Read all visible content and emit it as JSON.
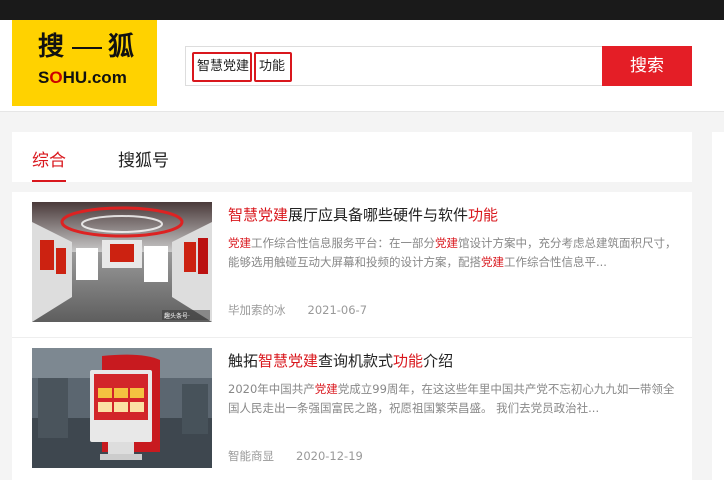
{
  "logo": {
    "cn_left": "搜",
    "cn_right": "狐",
    "en_pre": "S",
    "en_o": "O",
    "en_post": "HU.com"
  },
  "search": {
    "terms": [
      "智慧党建",
      "功能"
    ],
    "button_label": "搜索"
  },
  "tabs": [
    {
      "label": "综合",
      "active": true
    },
    {
      "label": "搜狐号",
      "active": false
    }
  ],
  "results": [
    {
      "title_parts": [
        {
          "text": "智慧党建",
          "hl": true
        },
        {
          "text": "展厅应具备哪些硬件与软件",
          "hl": false
        },
        {
          "text": "功能",
          "hl": true
        }
      ],
      "desc_parts": [
        {
          "text": "党建",
          "hl": true
        },
        {
          "text": "工作综合性信息服务平台：在一部分",
          "hl": false
        },
        {
          "text": "党建",
          "hl": true
        },
        {
          "text": "馆设计方案中，充分考虑总建筑面积尺寸，能够选用触碰互动大屏幕和投频的设计方案，配搭",
          "hl": false
        },
        {
          "text": "党建",
          "hl": true
        },
        {
          "text": "工作综合性信息平...",
          "hl": false
        }
      ],
      "author": "毕加索的冰",
      "date": "2021-06-7",
      "thumb_watermark": "趣头条号·",
      "colors": {
        "accent": "#d9171d"
      }
    },
    {
      "title_parts": [
        {
          "text": "触拓",
          "hl": false
        },
        {
          "text": "智慧党建",
          "hl": true
        },
        {
          "text": "查询机款式",
          "hl": false
        },
        {
          "text": "功能",
          "hl": true
        },
        {
          "text": "介绍",
          "hl": false
        }
      ],
      "desc_parts": [
        {
          "text": "2020年中国共产",
          "hl": false
        },
        {
          "text": "党建",
          "hl": true
        },
        {
          "text": "党成立99周年，在这这些年里中国共产党不忘初心九九如一带领全国人民走出一条强国富民之路，祝愿祖国繁荣昌盛。 我们去党员政治社...",
          "hl": false
        }
      ],
      "author": "智能商显",
      "date": "2020-12-19"
    }
  ],
  "colors": {
    "brand_yellow": "#ffd200",
    "accent_red": "#e41e26",
    "topbar": "#1a1a1a"
  }
}
